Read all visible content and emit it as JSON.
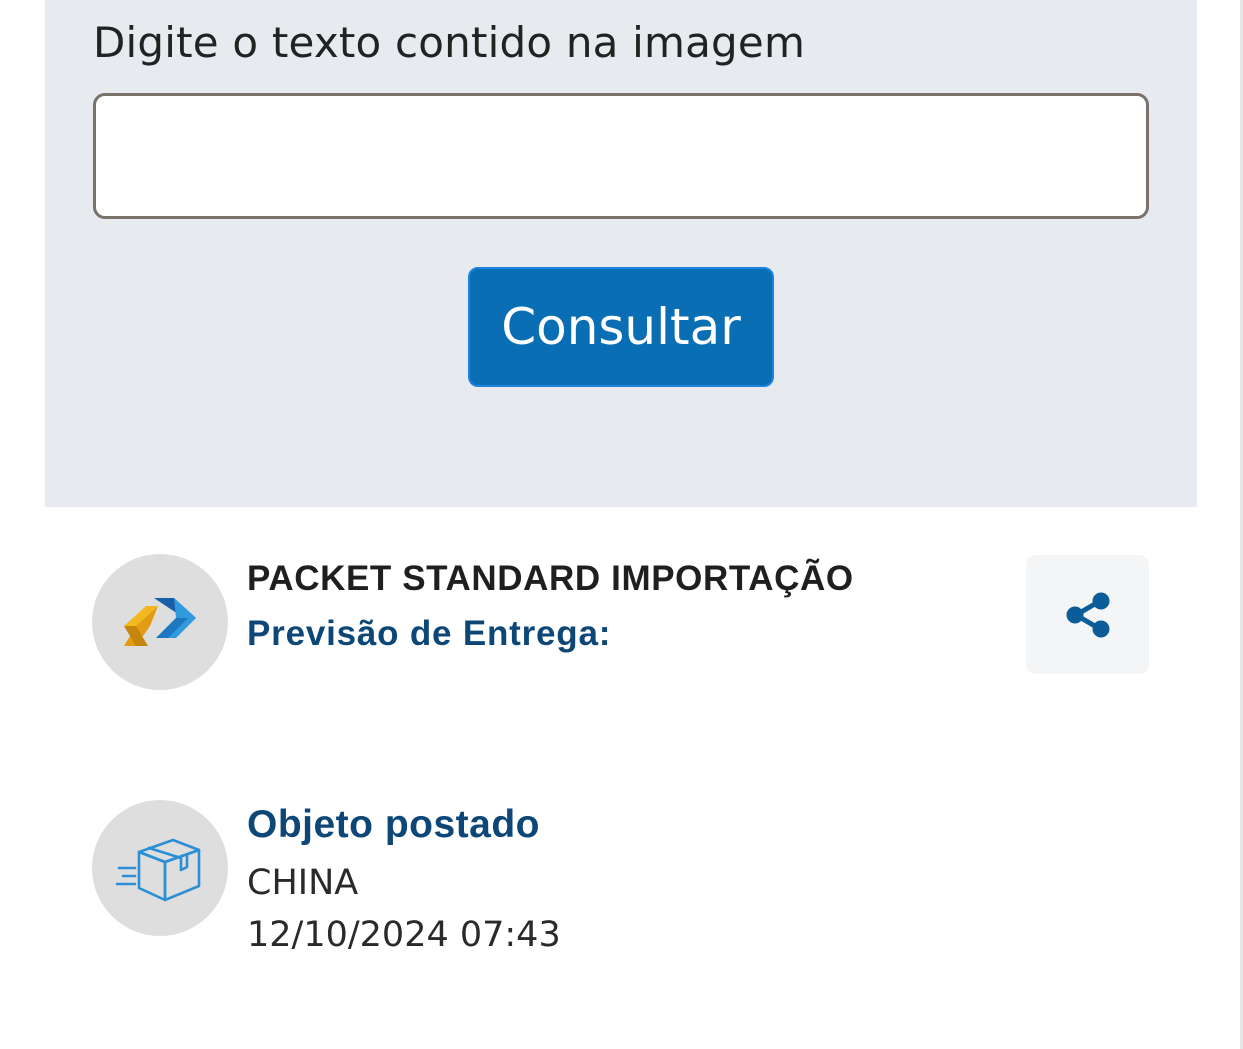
{
  "captcha": {
    "label": "Digite o texto contido na imagem",
    "input_value": "",
    "button_label": "Consultar"
  },
  "service": {
    "name": "PACKET STANDARD IMPORTAÇÃO",
    "forecast_label": "Previsão de Entrega:",
    "logo_icon": "correios-logo-icon",
    "share_icon": "share-icon"
  },
  "events": [
    {
      "icon": "package-sent-icon",
      "title": "Objeto postado",
      "location": "CHINA",
      "datetime": "12/10/2024 07:43"
    }
  ],
  "colors": {
    "panel_bg": "#e7eaee",
    "primary_button": "#0a6eb4",
    "heading_blue": "#0d4777",
    "icon_blue": "#0b5d9a",
    "circle_bg": "#dedede"
  }
}
